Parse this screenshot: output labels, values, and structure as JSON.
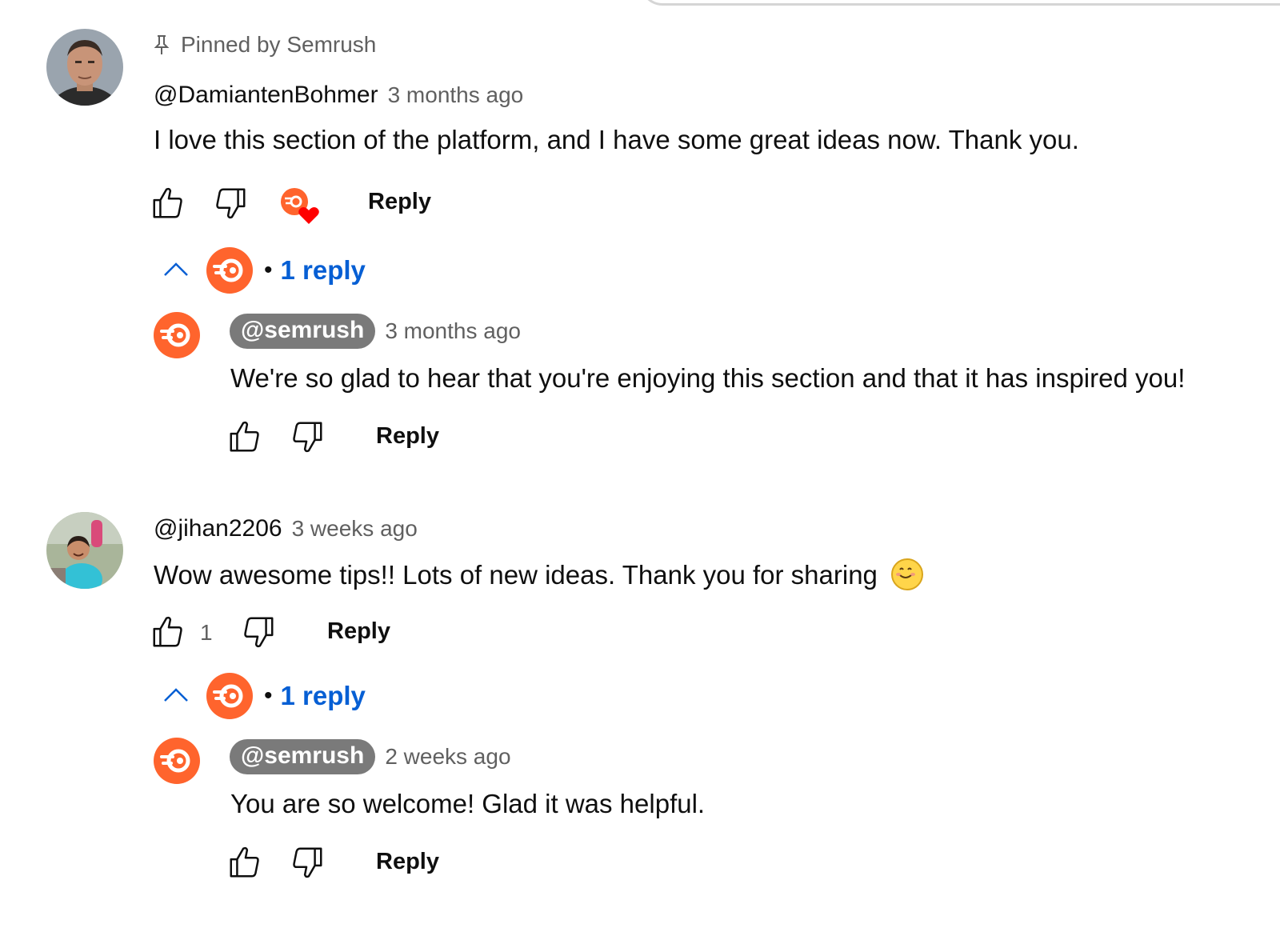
{
  "comments": [
    {
      "pinned_label": "Pinned by Semrush",
      "author": "@DamiantenBohmer",
      "time": "3 months ago",
      "text": "I love this section of the platform, and I have some great ideas now. Thank you.",
      "reply_label": "Reply",
      "hearted_by_creator": true,
      "replies_toggle": {
        "label": "1 reply",
        "expanded": true
      },
      "replies": [
        {
          "author": "@semrush",
          "time": "3 months ago",
          "text": "We're so glad to hear that you're enjoying this section and that it has inspired you!",
          "reply_label": "Reply"
        }
      ]
    },
    {
      "author": "@jihan2206",
      "time": "3 weeks ago",
      "text": "Wow awesome tips!! Lots of new ideas. Thank you for sharing",
      "emoji": "smiling-face",
      "like_count": "1",
      "reply_label": "Reply",
      "replies_toggle": {
        "label": "1 reply",
        "expanded": true
      },
      "replies": [
        {
          "author": "@semrush",
          "time": "2 weeks ago",
          "text": "You are so welcome! Glad it was helpful.",
          "reply_label": "Reply"
        }
      ]
    }
  ],
  "colors": {
    "brand_orange": "#ff642d",
    "link_blue": "#065fd4",
    "heart_red": "#ff0000",
    "secondary_text": "#606060",
    "chip_gray": "#7a7a7a"
  },
  "icons": [
    "pin-icon",
    "thumbs-up-icon",
    "thumbs-down-icon",
    "creator-heart-icon",
    "chevron-up-icon",
    "semrush-logo"
  ]
}
